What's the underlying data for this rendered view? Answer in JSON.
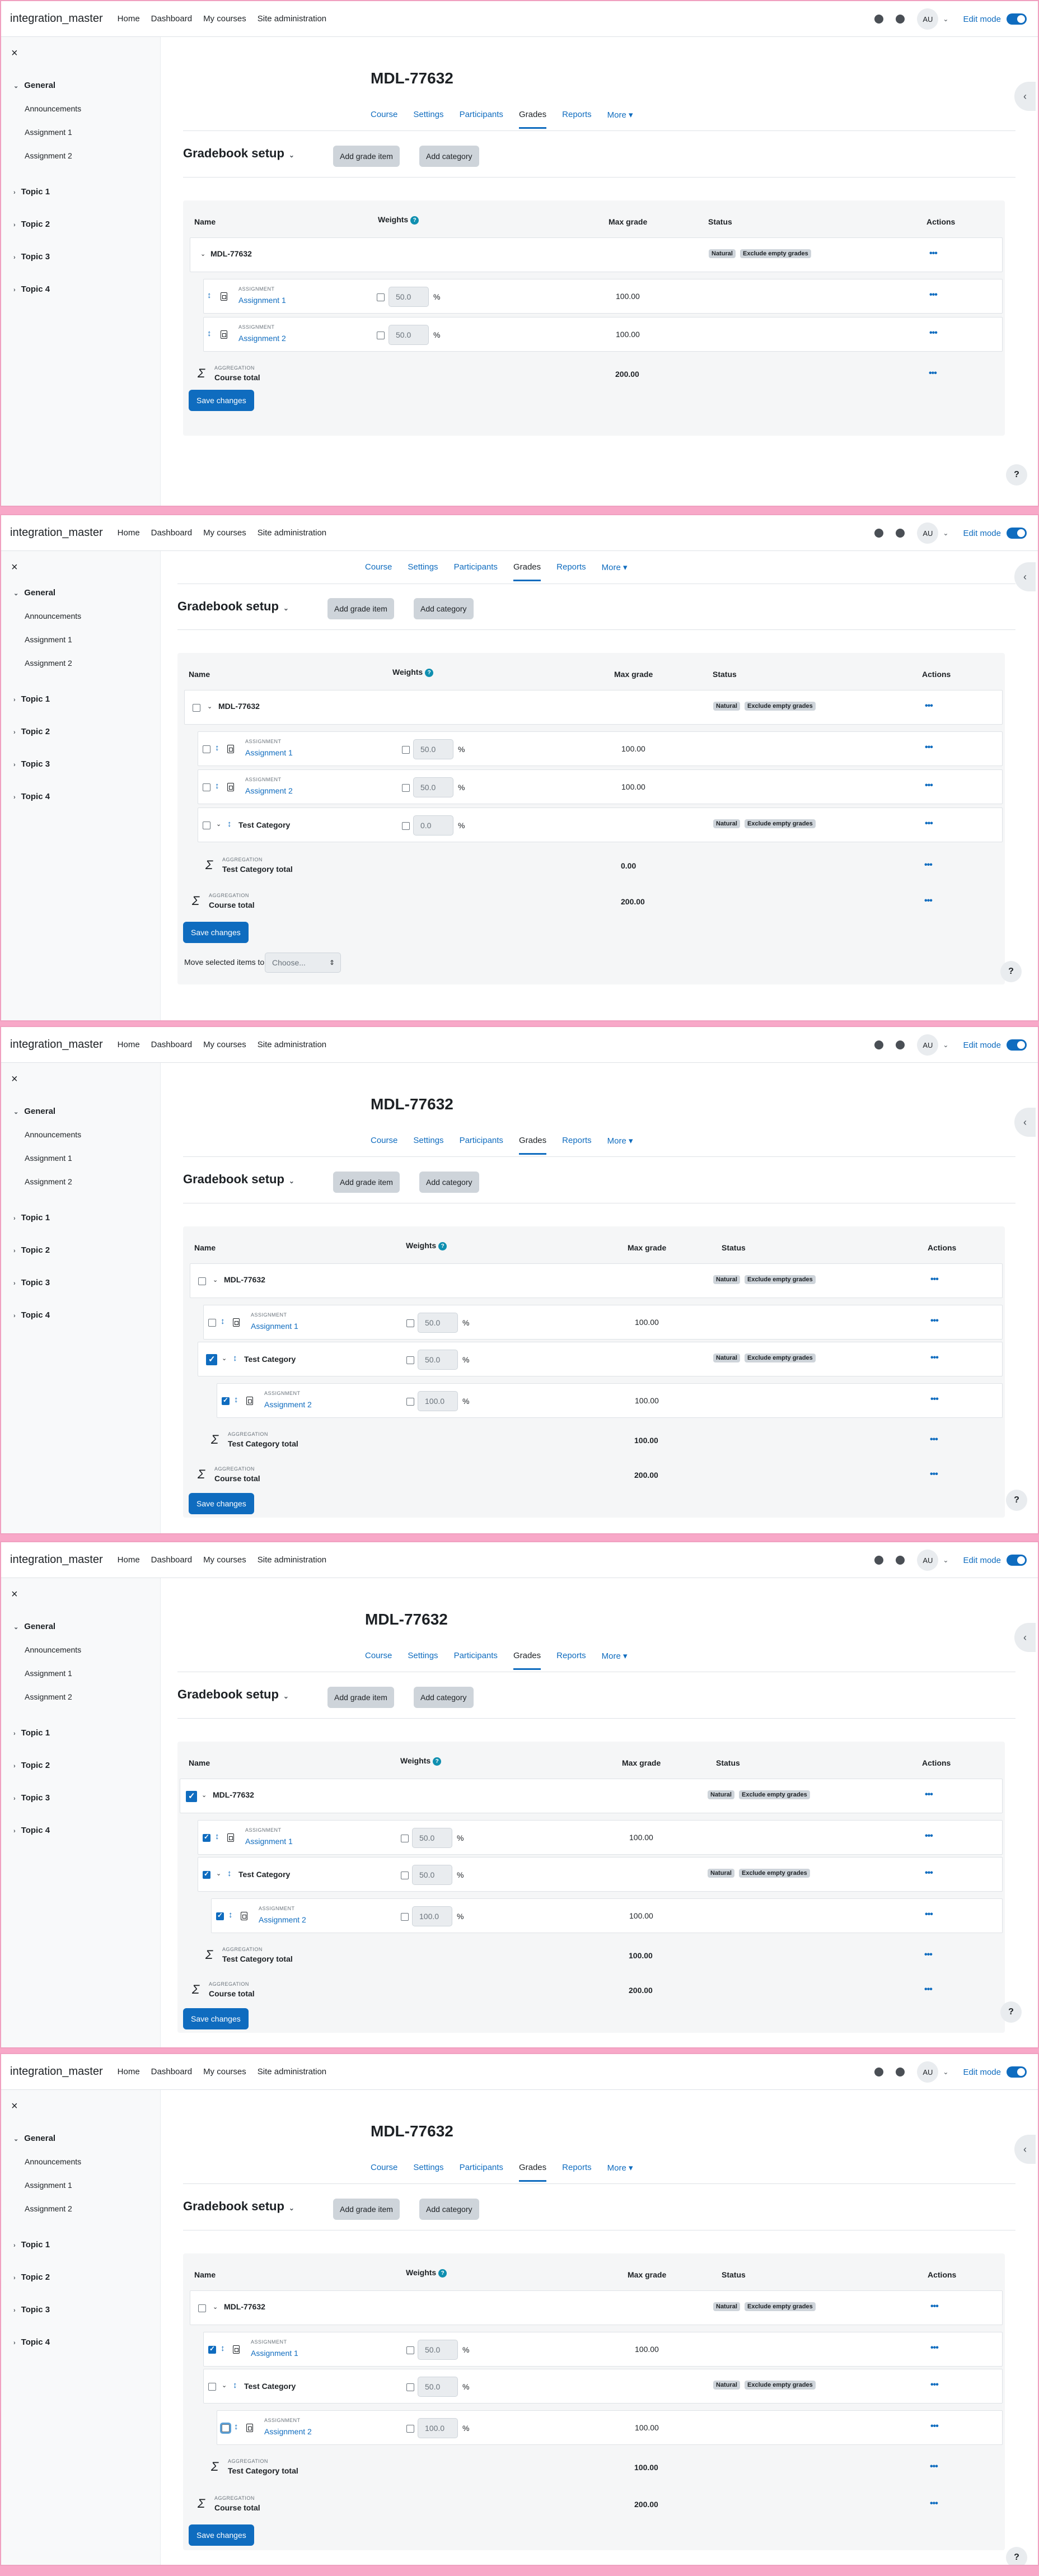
{
  "nav": {
    "brand": "integration_master",
    "links": [
      "Home",
      "Dashboard",
      "My courses",
      "Site administration"
    ],
    "avatar": "AU",
    "edit_mode": "Edit mode"
  },
  "drawer": {
    "close": "×",
    "general": "General",
    "items": [
      "Announcements",
      "Assignment 1",
      "Assignment 2"
    ],
    "topics": [
      "Topic 1",
      "Topic 2",
      "Topic 3",
      "Topic 4"
    ]
  },
  "course": {
    "title": "MDL-77632",
    "tabs": [
      "Course",
      "Settings",
      "Participants",
      "Grades",
      "Reports",
      "More ▾"
    ]
  },
  "gradebook": {
    "heading": "Gradebook setup",
    "add_grade_item": "Add grade item",
    "add_category": "Add category",
    "cols": {
      "name": "Name",
      "weights": "Weights",
      "max_grade": "Max grade",
      "status": "Status",
      "actions": "Actions"
    },
    "badge_natural": "Natural",
    "badge_exclude": "Exclude empty grades",
    "label_assignment": "ASSIGNMENT",
    "label_aggregation": "AGGREGATION",
    "course_name": "MDL-77632",
    "assignment1": "Assignment 1",
    "assignment2": "Assignment 2",
    "test_category": "Test Category",
    "test_category_total": "Test Category total",
    "course_total": "Course total",
    "w50": "50.0",
    "w0": "0.0",
    "w100": "100.0",
    "pct": "%",
    "grade_100": "100.00",
    "grade_0": "0.00",
    "grade_200": "200.00",
    "save_changes": "Save changes",
    "move_label": "Move selected items to",
    "move_choose": "Choose...",
    "dots": "•••",
    "help": "?"
  }
}
